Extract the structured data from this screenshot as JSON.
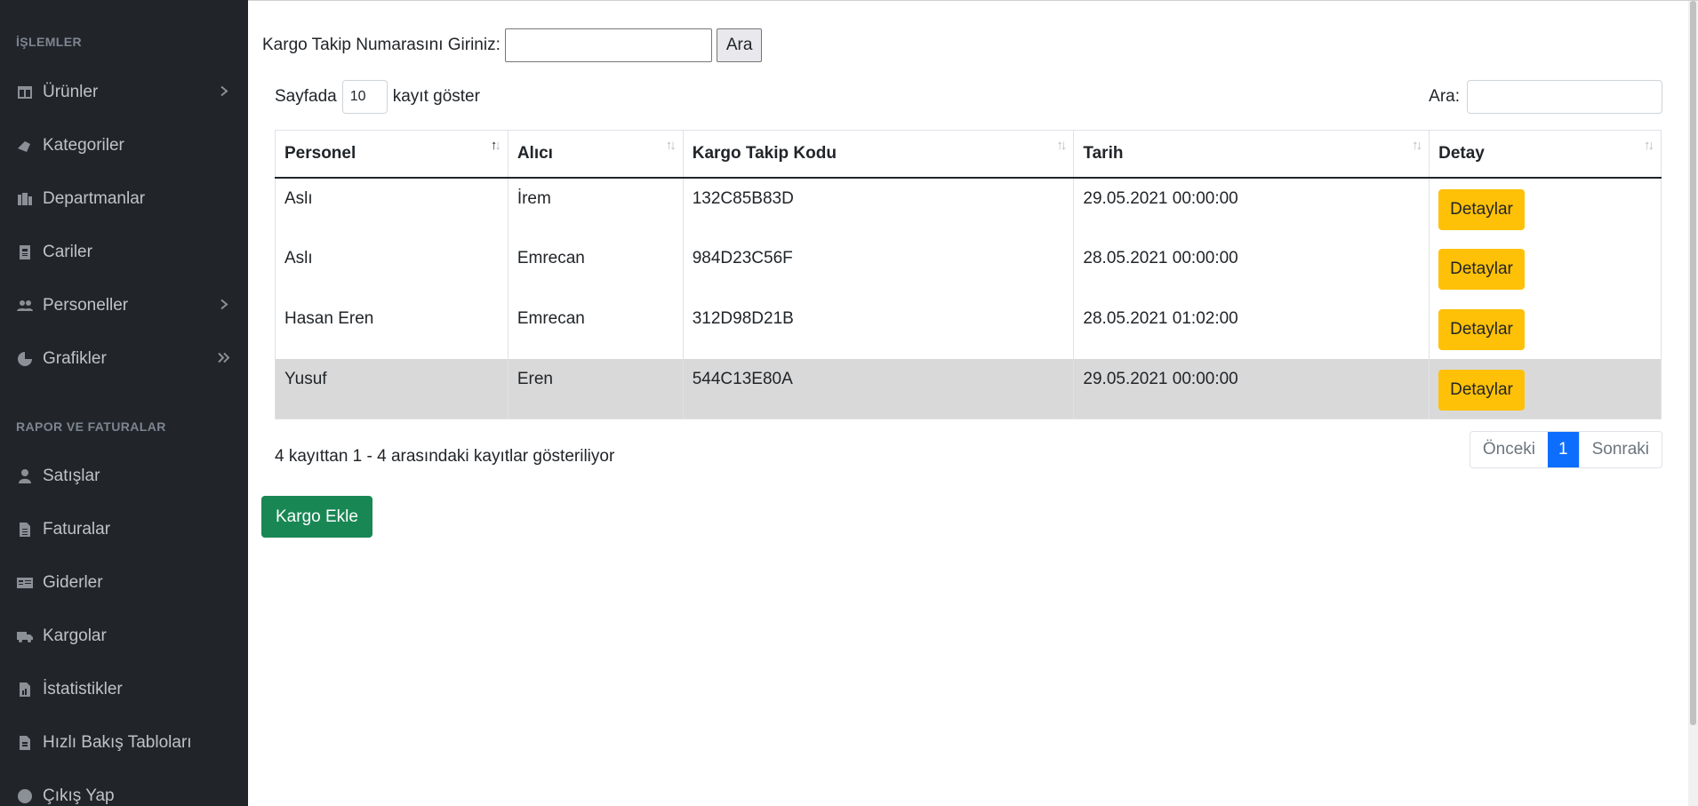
{
  "sidebar": {
    "section1": "İŞLEMLER",
    "section2": "RAPOR VE FATURALAR",
    "items": [
      {
        "label": "Ürünler",
        "icon": "table-icon"
      },
      {
        "label": "Kategoriler",
        "icon": "tags-icon"
      },
      {
        "label": "Departmanlar",
        "icon": "building-icon"
      },
      {
        "label": "Cariler",
        "icon": "id-card-icon"
      },
      {
        "label": "Personeller",
        "icon": "users-icon"
      },
      {
        "label": "Grafikler",
        "icon": "chart-pie-icon"
      },
      {
        "label": "Satışlar",
        "icon": "user-icon"
      },
      {
        "label": "Faturalar",
        "icon": "file-icon"
      },
      {
        "label": "Giderler",
        "icon": "money-check-icon"
      },
      {
        "label": "Kargolar",
        "icon": "truck-icon"
      },
      {
        "label": "İstatistikler",
        "icon": "file-chart-icon"
      },
      {
        "label": "Hızlı Bakış Tabloları",
        "icon": "file-table-icon"
      },
      {
        "label": "Çıkış Yap",
        "icon": "logout-icon"
      }
    ]
  },
  "tracking": {
    "label": "Kargo Takip Numarasını Giriniz:",
    "input_value": "",
    "button": "Ara"
  },
  "table_controls": {
    "length_prefix": "Sayfada",
    "length_value": "10",
    "length_suffix": "kayıt göster",
    "search_label": "Ara:",
    "search_value": ""
  },
  "table": {
    "columns": [
      "Personel",
      "Alıcı",
      "Kargo Takip Kodu",
      "Tarih",
      "Detay"
    ],
    "rows": [
      {
        "personel": "Aslı",
        "alici": "İrem",
        "kod": "132C85B83D",
        "tarih": "29.05.2021 00:00:00",
        "detay": "Detaylar"
      },
      {
        "personel": "Aslı",
        "alici": "Emrecan",
        "kod": "984D23C56F",
        "tarih": "28.05.2021 00:00:00",
        "detay": "Detaylar"
      },
      {
        "personel": "Hasan Eren",
        "alici": "Emrecan",
        "kod": "312D98D21B",
        "tarih": "28.05.2021 01:02:00",
        "detay": "Detaylar"
      },
      {
        "personel": "Yusuf",
        "alici": "Eren",
        "kod": "544C13E80A",
        "tarih": "29.05.2021 00:00:00",
        "detay": "Detaylar"
      }
    ]
  },
  "footer": {
    "info": "4 kayıttan 1 - 4 arasındaki kayıtlar gösteriliyor",
    "prev": "Önceki",
    "page": "1",
    "next": "Sonraki"
  },
  "add_button": "Kargo Ekle",
  "colors": {
    "sidebar_bg": "#212529",
    "detail_button": "#ffc107",
    "add_button": "#198754",
    "active_page": "#0d6efd",
    "highlight_row": "#d9d9d9"
  }
}
